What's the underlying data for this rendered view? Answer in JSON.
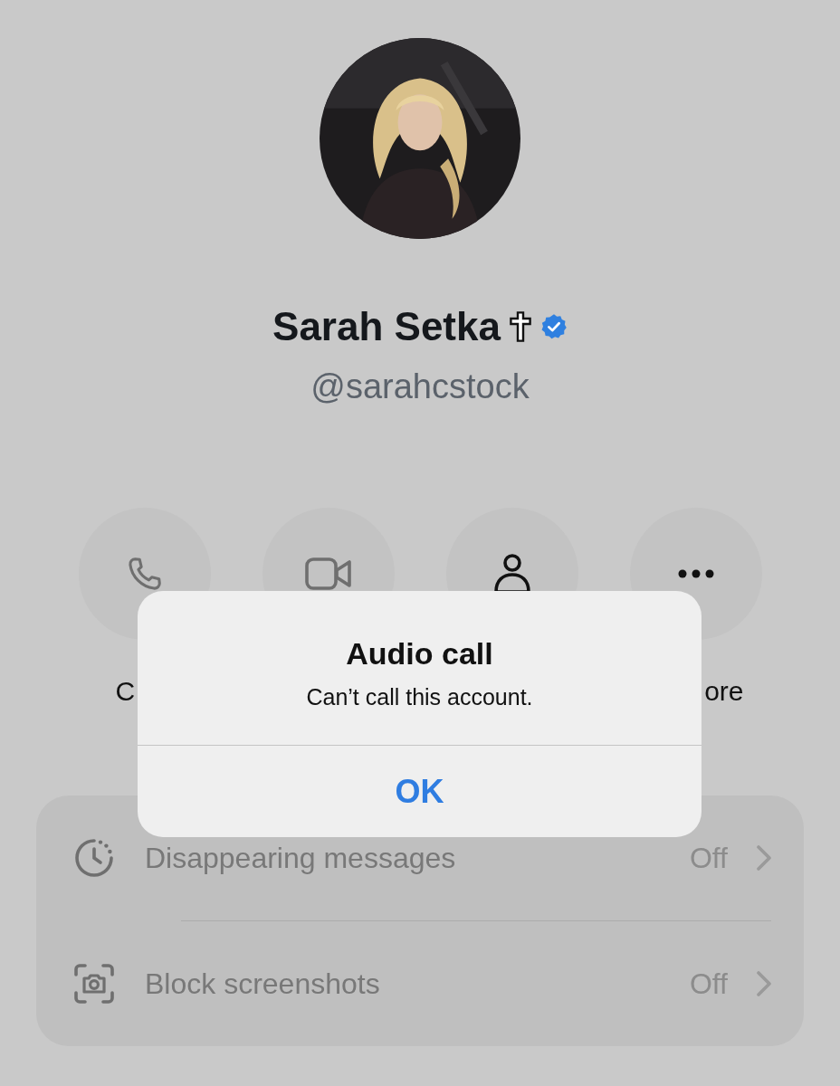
{
  "profile": {
    "name": "Sarah Setka",
    "handle": "@sarahcstock",
    "verified": true
  },
  "actions": [
    {
      "kind": "phone",
      "label": "C"
    },
    {
      "kind": "video"
    },
    {
      "kind": "person"
    },
    {
      "kind": "more",
      "label": "ore"
    }
  ],
  "settings": [
    {
      "kind": "timer",
      "label": "Disappearing messages",
      "value": "Off"
    },
    {
      "kind": "screenshot",
      "label": "Block screenshots",
      "value": "Off"
    }
  ],
  "alert": {
    "title": "Audio call",
    "message": "Can’t call this account.",
    "button": "OK"
  }
}
